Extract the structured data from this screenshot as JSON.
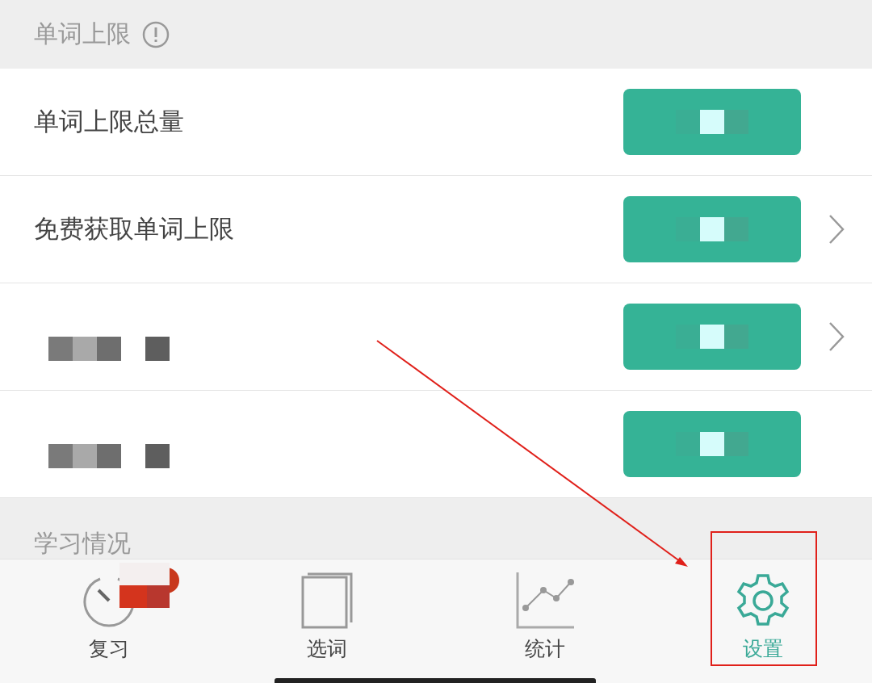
{
  "section_header": {
    "title": "单词上限"
  },
  "rows": [
    {
      "kind": "text",
      "label": "单词上限总量",
      "chevron": false
    },
    {
      "kind": "text",
      "label": "免费获取单词上限",
      "chevron": true
    },
    {
      "kind": "redacted",
      "chevron": true
    },
    {
      "kind": "redacted",
      "chevron": false
    }
  ],
  "section_header_2": {
    "title": "学习情况"
  },
  "tabs": [
    {
      "kind": "gauge",
      "label": "复习",
      "badge": true,
      "selected": false,
      "highlighted": false
    },
    {
      "kind": "book",
      "label": "选词",
      "badge": false,
      "selected": false,
      "highlighted": false
    },
    {
      "kind": "chart",
      "label": "统计",
      "badge": false,
      "selected": false,
      "highlighted": false
    },
    {
      "kind": "gear",
      "label": "设置",
      "badge": false,
      "selected": true,
      "highlighted": true
    }
  ]
}
